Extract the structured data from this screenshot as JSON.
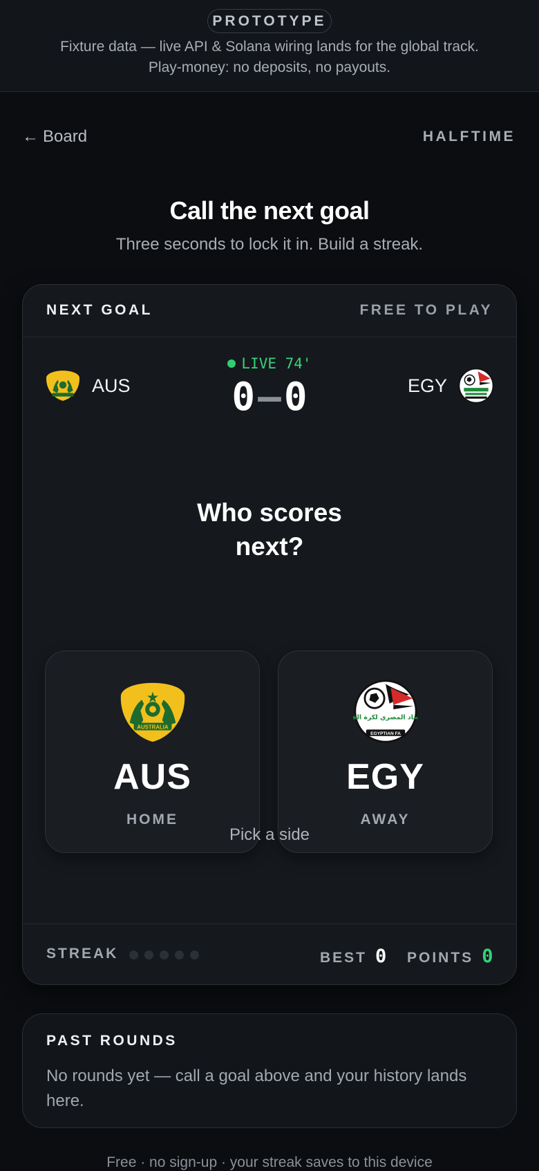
{
  "banner": {
    "pill": "PROTOTYPE",
    "line1": "Fixture data — live API & Solana wiring lands for the global track.",
    "line2": "Play-money: no deposits, no payouts."
  },
  "nav": {
    "back_arrow": "←",
    "back_label": "Board",
    "phase": "HALFTIME"
  },
  "hero": {
    "title": "Call the next goal",
    "subtitle": "Three seconds to lock it in. Build a streak."
  },
  "card": {
    "header_left": "NEXT GOAL",
    "header_right": "FREE TO PLAY",
    "home": {
      "code": "AUS",
      "side": "HOME",
      "crest_icon": "australia-crest-icon",
      "crest_text": "AUSTRALIA"
    },
    "away": {
      "code": "EGY",
      "side": "AWAY",
      "crest_icon": "egypt-crest-icon",
      "crest_text": "EGYPTIAN FA",
      "crest_arabic": "الاتحاد المصري لكرة القدم"
    },
    "live_label": "LIVE 74'",
    "score_home": "0",
    "score_sep": "–",
    "score_away": "0",
    "question_line1": "Who scores",
    "question_line2": "next?",
    "pick_hint": "Pick a side",
    "streak_label": "STREAK",
    "streak_count": 0,
    "streak_max": 5,
    "best_label": "BEST",
    "best_value": "0",
    "points_label": "POINTS",
    "points_value": "0"
  },
  "past_rounds": {
    "title": "PAST ROUNDS",
    "empty_text": "No rounds yet — call a goal above and your history lands here."
  },
  "footer": {
    "text": "Free · no sign-up · your streak saves to this device"
  },
  "colors": {
    "accent_green": "#32d27a",
    "background": "#0b0d10",
    "card": "#15181c"
  }
}
